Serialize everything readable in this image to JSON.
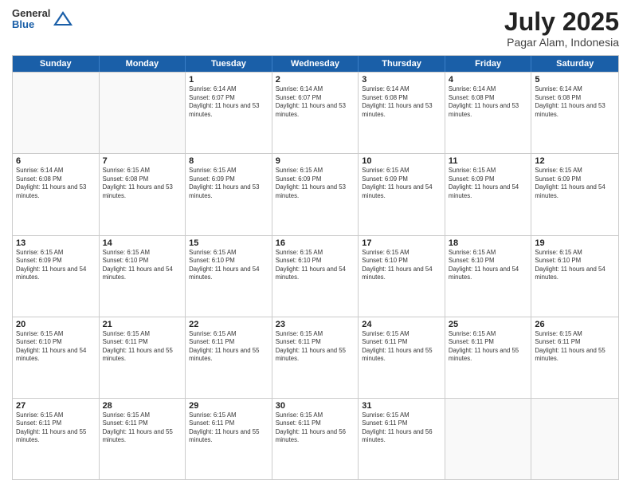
{
  "header": {
    "logo": {
      "general": "General",
      "blue": "Blue"
    },
    "title": "July 2025",
    "subtitle": "Pagar Alam, Indonesia"
  },
  "days_of_week": [
    "Sunday",
    "Monday",
    "Tuesday",
    "Wednesday",
    "Thursday",
    "Friday",
    "Saturday"
  ],
  "weeks": [
    [
      {
        "day": "",
        "empty": true
      },
      {
        "day": "",
        "empty": true
      },
      {
        "day": "1",
        "sunrise": "Sunrise: 6:14 AM",
        "sunset": "Sunset: 6:07 PM",
        "daylight": "Daylight: 11 hours and 53 minutes."
      },
      {
        "day": "2",
        "sunrise": "Sunrise: 6:14 AM",
        "sunset": "Sunset: 6:07 PM",
        "daylight": "Daylight: 11 hours and 53 minutes."
      },
      {
        "day": "3",
        "sunrise": "Sunrise: 6:14 AM",
        "sunset": "Sunset: 6:08 PM",
        "daylight": "Daylight: 11 hours and 53 minutes."
      },
      {
        "day": "4",
        "sunrise": "Sunrise: 6:14 AM",
        "sunset": "Sunset: 6:08 PM",
        "daylight": "Daylight: 11 hours and 53 minutes."
      },
      {
        "day": "5",
        "sunrise": "Sunrise: 6:14 AM",
        "sunset": "Sunset: 6:08 PM",
        "daylight": "Daylight: 11 hours and 53 minutes."
      }
    ],
    [
      {
        "day": "6",
        "sunrise": "Sunrise: 6:14 AM",
        "sunset": "Sunset: 6:08 PM",
        "daylight": "Daylight: 11 hours and 53 minutes."
      },
      {
        "day": "7",
        "sunrise": "Sunrise: 6:15 AM",
        "sunset": "Sunset: 6:08 PM",
        "daylight": "Daylight: 11 hours and 53 minutes."
      },
      {
        "day": "8",
        "sunrise": "Sunrise: 6:15 AM",
        "sunset": "Sunset: 6:09 PM",
        "daylight": "Daylight: 11 hours and 53 minutes."
      },
      {
        "day": "9",
        "sunrise": "Sunrise: 6:15 AM",
        "sunset": "Sunset: 6:09 PM",
        "daylight": "Daylight: 11 hours and 53 minutes."
      },
      {
        "day": "10",
        "sunrise": "Sunrise: 6:15 AM",
        "sunset": "Sunset: 6:09 PM",
        "daylight": "Daylight: 11 hours and 54 minutes."
      },
      {
        "day": "11",
        "sunrise": "Sunrise: 6:15 AM",
        "sunset": "Sunset: 6:09 PM",
        "daylight": "Daylight: 11 hours and 54 minutes."
      },
      {
        "day": "12",
        "sunrise": "Sunrise: 6:15 AM",
        "sunset": "Sunset: 6:09 PM",
        "daylight": "Daylight: 11 hours and 54 minutes."
      }
    ],
    [
      {
        "day": "13",
        "sunrise": "Sunrise: 6:15 AM",
        "sunset": "Sunset: 6:09 PM",
        "daylight": "Daylight: 11 hours and 54 minutes."
      },
      {
        "day": "14",
        "sunrise": "Sunrise: 6:15 AM",
        "sunset": "Sunset: 6:10 PM",
        "daylight": "Daylight: 11 hours and 54 minutes."
      },
      {
        "day": "15",
        "sunrise": "Sunrise: 6:15 AM",
        "sunset": "Sunset: 6:10 PM",
        "daylight": "Daylight: 11 hours and 54 minutes."
      },
      {
        "day": "16",
        "sunrise": "Sunrise: 6:15 AM",
        "sunset": "Sunset: 6:10 PM",
        "daylight": "Daylight: 11 hours and 54 minutes."
      },
      {
        "day": "17",
        "sunrise": "Sunrise: 6:15 AM",
        "sunset": "Sunset: 6:10 PM",
        "daylight": "Daylight: 11 hours and 54 minutes."
      },
      {
        "day": "18",
        "sunrise": "Sunrise: 6:15 AM",
        "sunset": "Sunset: 6:10 PM",
        "daylight": "Daylight: 11 hours and 54 minutes."
      },
      {
        "day": "19",
        "sunrise": "Sunrise: 6:15 AM",
        "sunset": "Sunset: 6:10 PM",
        "daylight": "Daylight: 11 hours and 54 minutes."
      }
    ],
    [
      {
        "day": "20",
        "sunrise": "Sunrise: 6:15 AM",
        "sunset": "Sunset: 6:10 PM",
        "daylight": "Daylight: 11 hours and 54 minutes."
      },
      {
        "day": "21",
        "sunrise": "Sunrise: 6:15 AM",
        "sunset": "Sunset: 6:11 PM",
        "daylight": "Daylight: 11 hours and 55 minutes."
      },
      {
        "day": "22",
        "sunrise": "Sunrise: 6:15 AM",
        "sunset": "Sunset: 6:11 PM",
        "daylight": "Daylight: 11 hours and 55 minutes."
      },
      {
        "day": "23",
        "sunrise": "Sunrise: 6:15 AM",
        "sunset": "Sunset: 6:11 PM",
        "daylight": "Daylight: 11 hours and 55 minutes."
      },
      {
        "day": "24",
        "sunrise": "Sunrise: 6:15 AM",
        "sunset": "Sunset: 6:11 PM",
        "daylight": "Daylight: 11 hours and 55 minutes."
      },
      {
        "day": "25",
        "sunrise": "Sunrise: 6:15 AM",
        "sunset": "Sunset: 6:11 PM",
        "daylight": "Daylight: 11 hours and 55 minutes."
      },
      {
        "day": "26",
        "sunrise": "Sunrise: 6:15 AM",
        "sunset": "Sunset: 6:11 PM",
        "daylight": "Daylight: 11 hours and 55 minutes."
      }
    ],
    [
      {
        "day": "27",
        "sunrise": "Sunrise: 6:15 AM",
        "sunset": "Sunset: 6:11 PM",
        "daylight": "Daylight: 11 hours and 55 minutes."
      },
      {
        "day": "28",
        "sunrise": "Sunrise: 6:15 AM",
        "sunset": "Sunset: 6:11 PM",
        "daylight": "Daylight: 11 hours and 55 minutes."
      },
      {
        "day": "29",
        "sunrise": "Sunrise: 6:15 AM",
        "sunset": "Sunset: 6:11 PM",
        "daylight": "Daylight: 11 hours and 55 minutes."
      },
      {
        "day": "30",
        "sunrise": "Sunrise: 6:15 AM",
        "sunset": "Sunset: 6:11 PM",
        "daylight": "Daylight: 11 hours and 56 minutes."
      },
      {
        "day": "31",
        "sunrise": "Sunrise: 6:15 AM",
        "sunset": "Sunset: 6:11 PM",
        "daylight": "Daylight: 11 hours and 56 minutes."
      },
      {
        "day": "",
        "empty": true
      },
      {
        "day": "",
        "empty": true
      }
    ]
  ]
}
